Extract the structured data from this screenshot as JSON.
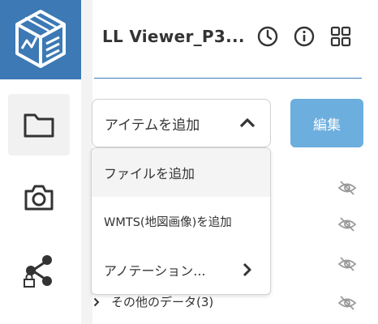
{
  "header": {
    "title": "LL Viewer_P3...",
    "icons": [
      "clock-icon",
      "info-icon",
      "grid-icon"
    ]
  },
  "sidebar": {
    "items": [
      {
        "name": "folder-icon",
        "active": true
      },
      {
        "name": "camera-icon",
        "active": false
      },
      {
        "name": "share-lock-icon",
        "active": false
      }
    ]
  },
  "toolbar": {
    "add_item_label": "アイテムを追加",
    "edit_label": "編集"
  },
  "menu": {
    "items": [
      {
        "label": "ファイルを追加"
      },
      {
        "label": "WMTS(地図画像)を追加"
      },
      {
        "label": "アノテーション..."
      }
    ]
  },
  "list": {
    "other_data_label": "その他のデータ(3)"
  },
  "colors": {
    "brand": "#3c79b5",
    "edit_button": "#6caede",
    "divider": "#3d7ab6"
  }
}
